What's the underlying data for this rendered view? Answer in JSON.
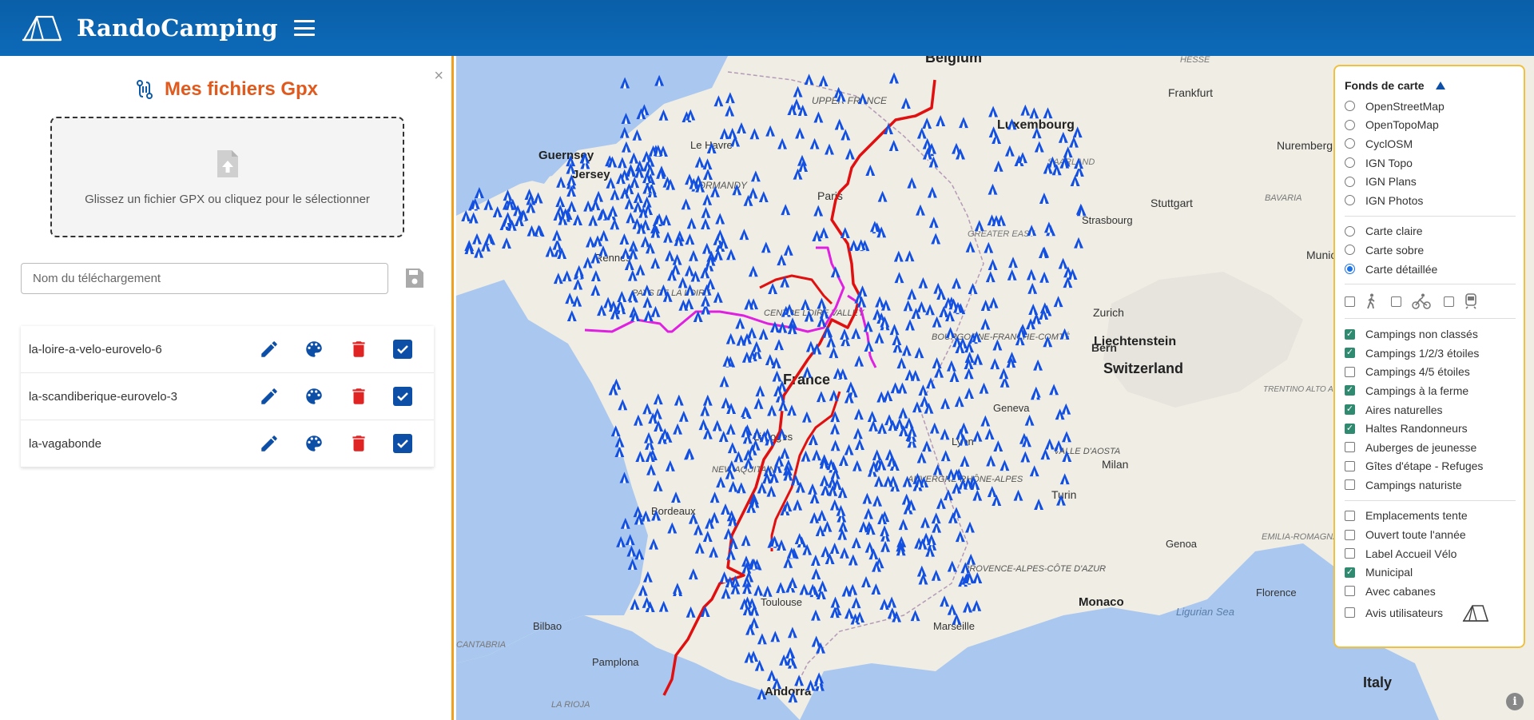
{
  "header": {
    "brand": "RandoCamping",
    "logo_icon": "tent-icon",
    "menu_icon": "hamburger-menu-icon",
    "bg_color": "#0a5fa8"
  },
  "gpx_panel": {
    "title": "Mes fichiers Gpx",
    "title_color": "#e05a1e",
    "close_label": "×",
    "drop_text": "Glissez un fichier GPX ou cliquez pour le sélectionner",
    "name_placeholder": "Nom du téléchargement",
    "files": [
      {
        "name": "la-loire-a-velo-eurovelo-6",
        "visible": true
      },
      {
        "name": "la-scandiberique-eurovelo-3",
        "visible": true
      },
      {
        "name": "la-vagabonde",
        "visible": true
      }
    ]
  },
  "map": {
    "labels": [
      {
        "text": "Belgium",
        "bold": true
      },
      {
        "text": "Luxembourg",
        "bold": true
      },
      {
        "text": "Frankfurt"
      },
      {
        "text": "HESSE"
      },
      {
        "text": "Nuremberg"
      },
      {
        "text": "UPPER FRANCE"
      },
      {
        "text": "Le Havre"
      },
      {
        "text": "Guernsey",
        "bold": true
      },
      {
        "text": "Jersey",
        "bold": true
      },
      {
        "text": "NORMANDY"
      },
      {
        "text": "Paris"
      },
      {
        "text": "SAARLAND"
      },
      {
        "text": "Stuttgart"
      },
      {
        "text": "BAVARIA"
      },
      {
        "text": "Strasbourg"
      },
      {
        "text": "GREATER EAST"
      },
      {
        "text": "Rennes"
      },
      {
        "text": "Munich"
      },
      {
        "text": "PAYS DE LA LOIRE"
      },
      {
        "text": "CENTRE LOIRE VALLEY"
      },
      {
        "text": "Zurich"
      },
      {
        "text": "Liechtenstein",
        "bold": true
      },
      {
        "text": "Bern"
      },
      {
        "text": "Switzerland",
        "bold": true
      },
      {
        "text": "BOURGOGNE-FRANCHE-COMTÉ"
      },
      {
        "text": "France",
        "bold": true
      },
      {
        "text": "TRENTINO ALTO ADIGE SÜDTIROL"
      },
      {
        "text": "Limoges"
      },
      {
        "text": "Geneva"
      },
      {
        "text": "Lyon"
      },
      {
        "text": "VALLE D'AOSTA"
      },
      {
        "text": "NEW AQUITAINE"
      },
      {
        "text": "AUVERGNE-RHÔNE-ALPES"
      },
      {
        "text": "Milan"
      },
      {
        "text": "Turin"
      },
      {
        "text": "Bordeaux"
      },
      {
        "text": "Genoa"
      },
      {
        "text": "EMILIA-ROMAGNA"
      },
      {
        "text": "PROVENCE-ALPES-CÔTE D'AZUR"
      },
      {
        "text": "Florence"
      },
      {
        "text": "Toulouse"
      },
      {
        "text": "Monaco",
        "bold": true
      },
      {
        "text": "Bilbao"
      },
      {
        "text": "Marseille"
      },
      {
        "text": "Ligurian Sea"
      },
      {
        "text": "CANTABRIA"
      },
      {
        "text": "Pamplona"
      },
      {
        "text": "Andorra",
        "bold": true
      },
      {
        "text": "Italy",
        "bold": true
      },
      {
        "text": "LA RIOJA"
      }
    ],
    "routes": [
      {
        "name": "la-loire-a-velo-eurovelo-6",
        "color": "#e01010"
      },
      {
        "name": "la-scandiberique-eurovelo-3",
        "color": "#e01010"
      },
      {
        "name": "la-vagabonde",
        "color": "#e020e0"
      }
    ],
    "marker_icon": "campsite-tent-icon",
    "marker_color": "#1450e0"
  },
  "layers": {
    "heading": "Fonds de carte",
    "basemaps": [
      {
        "label": "OpenStreetMap",
        "selected": false
      },
      {
        "label": "OpenTopoMap",
        "selected": false
      },
      {
        "label": "CyclOSM",
        "selected": false
      },
      {
        "label": "IGN Topo",
        "selected": false
      },
      {
        "label": "IGN Plans",
        "selected": false
      },
      {
        "label": "IGN Photos",
        "selected": false
      }
    ],
    "styles": [
      {
        "label": "Carte claire",
        "selected": false
      },
      {
        "label": "Carte sobre",
        "selected": false
      },
      {
        "label": "Carte détaillée",
        "selected": true
      }
    ],
    "transport_filters": [
      {
        "icon": "hiker-icon",
        "checked": false
      },
      {
        "icon": "cyclist-icon",
        "checked": false
      },
      {
        "icon": "train-icon",
        "checked": false
      }
    ],
    "categories": [
      {
        "label": "Campings non classés",
        "checked": true
      },
      {
        "label": "Campings 1/2/3 étoiles",
        "checked": true
      },
      {
        "label": "Campings 4/5 étoiles",
        "checked": false
      },
      {
        "label": "Campings à la ferme",
        "checked": true
      },
      {
        "label": "Aires naturelles",
        "checked": true
      },
      {
        "label": "Haltes Randonneurs",
        "checked": true
      },
      {
        "label": "Auberges de jeunesse",
        "checked": false
      },
      {
        "label": "Gîtes d'étape - Refuges",
        "checked": false
      },
      {
        "label": "Campings naturiste",
        "checked": false
      }
    ],
    "options": [
      {
        "label": "Emplacements tente",
        "checked": false
      },
      {
        "label": "Ouvert toute l'année",
        "checked": false
      },
      {
        "label": "Label Accueil Vélo",
        "checked": false
      },
      {
        "label": "Municipal",
        "checked": true
      },
      {
        "label": "Avec cabanes",
        "checked": false
      },
      {
        "label": "Avis utilisateurs",
        "checked": false
      }
    ]
  }
}
